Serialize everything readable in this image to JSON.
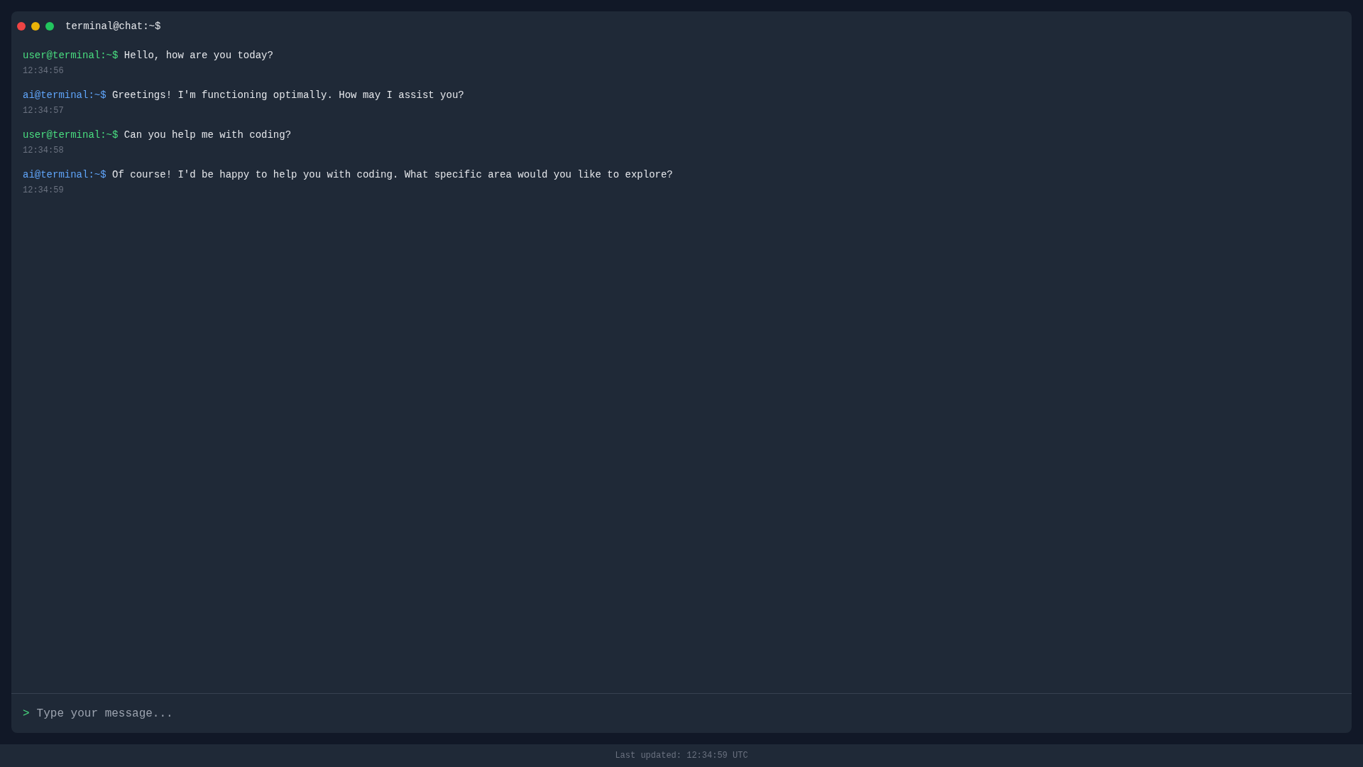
{
  "window": {
    "title": "terminal@chat:~$"
  },
  "messages": [
    {
      "kind": "user",
      "prompt": "user@terminal:~$",
      "text": "Hello, how are you today?",
      "time": "12:34:56"
    },
    {
      "kind": "ai",
      "prompt": "ai@terminal:~$",
      "text": "Greetings! I'm functioning optimally. How may I assist you?",
      "time": "12:34:57"
    },
    {
      "kind": "user",
      "prompt": "user@terminal:~$",
      "text": "Can you help me with coding?",
      "time": "12:34:58"
    },
    {
      "kind": "ai",
      "prompt": "ai@terminal:~$",
      "text": "Of course! I'd be happy to help you with coding. What specific area would you like to explore?",
      "time": "12:34:59"
    }
  ],
  "input": {
    "prompt": ">",
    "placeholder": "Type your message..."
  },
  "status_bar": {
    "text": "Last updated: 12:34:59 UTC"
  }
}
